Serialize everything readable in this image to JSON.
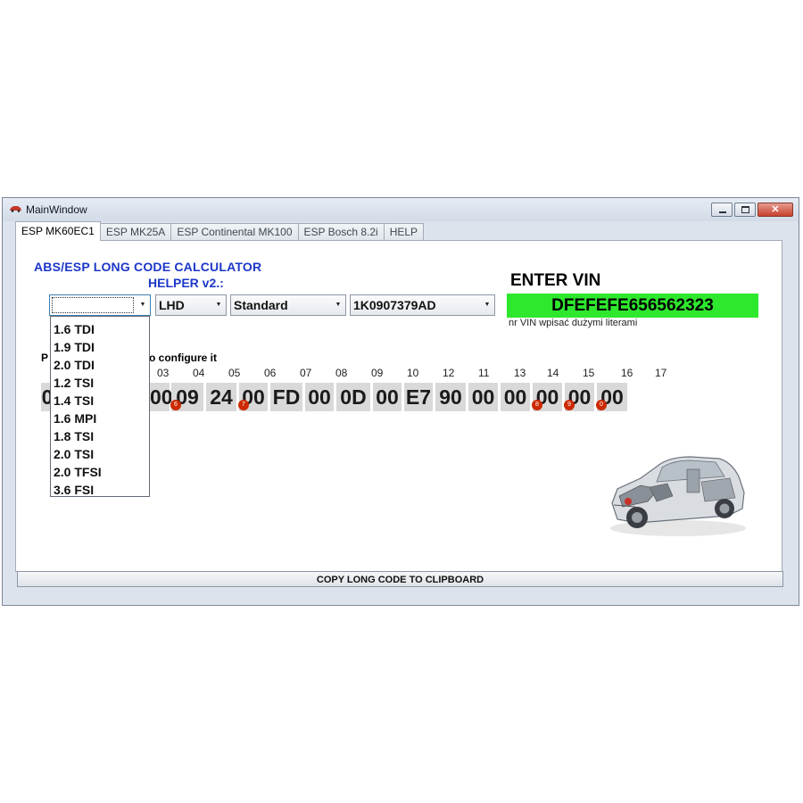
{
  "window": {
    "title": "MainWindow"
  },
  "tabs": [
    "ESP MK60EC1",
    "ESP MK25A",
    "ESP Continental MK100",
    "ESP Bosch 8.2i",
    "HELP"
  ],
  "header": {
    "line1": "ABS/ESP LONG CODE CALCULATOR",
    "line2": "HELPER v2.:"
  },
  "combos": {
    "engine": "",
    "drive_side": "LHD",
    "variant": "Standard",
    "part_number": "1K0907379AD"
  },
  "engine_options": [
    "1.6 TDI",
    "1.9 TDI",
    "2.0 TDI",
    "1.2 TSI",
    "1.4 TSI",
    "1.6 MPI",
    "1.8 TSI",
    "2.0 TSI",
    "2.0 TFSI",
    "3.6 FSI"
  ],
  "vin": {
    "title": "ENTER VIN",
    "value": "DFEFEFE656562323",
    "note": "nr VIN wpisać dużymi literami"
  },
  "instructions": {
    "start": "P",
    "end": "o configure it"
  },
  "byte_indices": [
    "03",
    "04",
    "05",
    "06",
    "07",
    "08",
    "09",
    "10",
    "11",
    "12",
    "13",
    "14",
    "15",
    "16",
    "17"
  ],
  "bytes": [
    "0",
    "00",
    "09",
    "24",
    "00",
    "FD",
    "00",
    "0D",
    "00",
    "E7",
    "90",
    "00",
    "00",
    "00",
    "00",
    "00"
  ],
  "markers": [
    "6",
    "7",
    "8",
    "9",
    "0"
  ],
  "copy_button": "COPY LONG CODE TO CLIPBOARD",
  "colors": {
    "heading": "#1c37c8",
    "vin_field": "#2ee82e",
    "marker": "#cc2a00"
  }
}
